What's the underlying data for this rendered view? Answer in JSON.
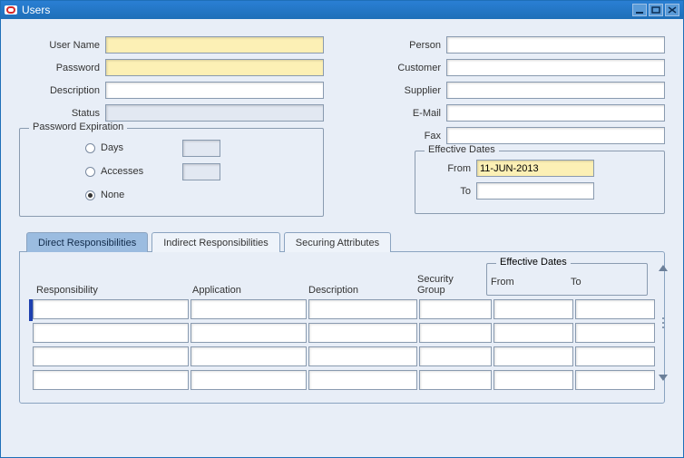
{
  "window": {
    "title": "Users"
  },
  "leftFields": {
    "userName": {
      "label": "User Name",
      "value": ""
    },
    "password": {
      "label": "Password",
      "value": ""
    },
    "description": {
      "label": "Description",
      "value": ""
    },
    "status": {
      "label": "Status",
      "value": ""
    }
  },
  "passwordExpiration": {
    "legend": "Password Expiration",
    "options": {
      "days": {
        "label": "Days",
        "value": ""
      },
      "accesses": {
        "label": "Accesses",
        "value": ""
      },
      "none": {
        "label": "None"
      }
    },
    "selected": "none"
  },
  "rightFields": {
    "person": {
      "label": "Person",
      "value": ""
    },
    "customer": {
      "label": "Customer",
      "value": ""
    },
    "supplier": {
      "label": "Supplier",
      "value": ""
    },
    "email": {
      "label": "E-Mail",
      "value": ""
    },
    "fax": {
      "label": "Fax",
      "value": ""
    }
  },
  "effectiveDates": {
    "legend": "Effective Dates",
    "from": {
      "label": "From",
      "value": "11-JUN-2013"
    },
    "to": {
      "label": "To",
      "value": ""
    }
  },
  "tabs": {
    "direct": "Direct Responsibilities",
    "indirect": "Indirect Responsibilities",
    "securing": "Securing Attributes",
    "active": "direct"
  },
  "grid": {
    "headers": {
      "responsibility": "Responsibility",
      "application": "Application",
      "description": "Description",
      "securityGroup": "Security\nGroup",
      "effectiveDates": "Effective Dates",
      "from": "From",
      "to": "To"
    },
    "rows": [
      {
        "responsibility": "",
        "application": "",
        "description": "",
        "securityGroup": "",
        "from": "",
        "to": ""
      },
      {
        "responsibility": "",
        "application": "",
        "description": "",
        "securityGroup": "",
        "from": "",
        "to": ""
      },
      {
        "responsibility": "",
        "application": "",
        "description": "",
        "securityGroup": "",
        "from": "",
        "to": ""
      },
      {
        "responsibility": "",
        "application": "",
        "description": "",
        "securityGroup": "",
        "from": "",
        "to": ""
      }
    ]
  }
}
